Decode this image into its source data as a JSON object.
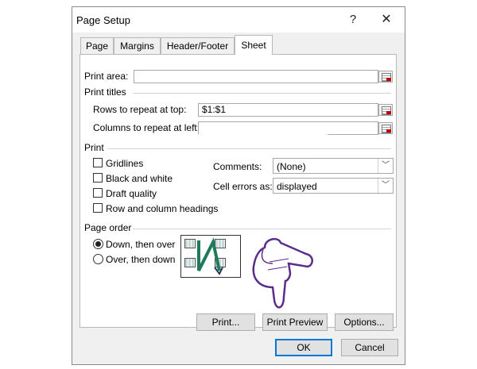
{
  "dialog": {
    "title": "Page Setup",
    "help_glyph": "?",
    "close_glyph": "✕"
  },
  "tabs": [
    "Page",
    "Margins",
    "Header/Footer",
    "Sheet"
  ],
  "active_tab": "Sheet",
  "print_area": {
    "label": "Print area:",
    "value": ""
  },
  "print_titles": {
    "heading": "Print titles",
    "rows_label": "Rows to repeat at top:",
    "rows_value": "$1:$1",
    "cols_label": "Columns to repeat at left:",
    "cols_value": ""
  },
  "print": {
    "heading": "Print",
    "checkboxes": [
      {
        "label": "Gridlines",
        "checked": false
      },
      {
        "label": "Black and white",
        "checked": false
      },
      {
        "label": "Draft quality",
        "checked": false
      },
      {
        "label": "Row and column headings",
        "checked": false
      }
    ],
    "comments_label": "Comments:",
    "comments_value": "(None)",
    "errors_label": "Cell errors as:",
    "errors_value": "displayed"
  },
  "page_order": {
    "heading": "Page order",
    "option_down": "Down, then over",
    "option_over": "Over, then down",
    "selected": "Down, then over"
  },
  "buttons": {
    "print": "Print...",
    "print_preview": "Print Preview",
    "options": "Options...",
    "ok": "OK",
    "cancel": "Cancel"
  },
  "colors": {
    "accent": "#0078d7",
    "hand_outline": "#5a2d8c",
    "hand_fill": "#ffffff",
    "order_arrow": "#1f7a5a"
  },
  "icons": [
    "help-icon",
    "close-icon",
    "collapse-range-icon",
    "chevron-down-icon",
    "pointing-hand-icon"
  ]
}
